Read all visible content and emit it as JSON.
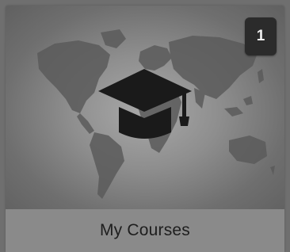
{
  "tile": {
    "label": "My Courses",
    "badge_count": "1",
    "icon": "graduation-cap-icon",
    "background_image": "world-map"
  },
  "colors": {
    "page_background": "#6f6f6f",
    "label_bar": "#8a8a8a",
    "badge_background": "#2b2b2b",
    "badge_text": "#f0f0f0",
    "icon": "#1a1a1a",
    "map_land": "#5a5a5a"
  }
}
